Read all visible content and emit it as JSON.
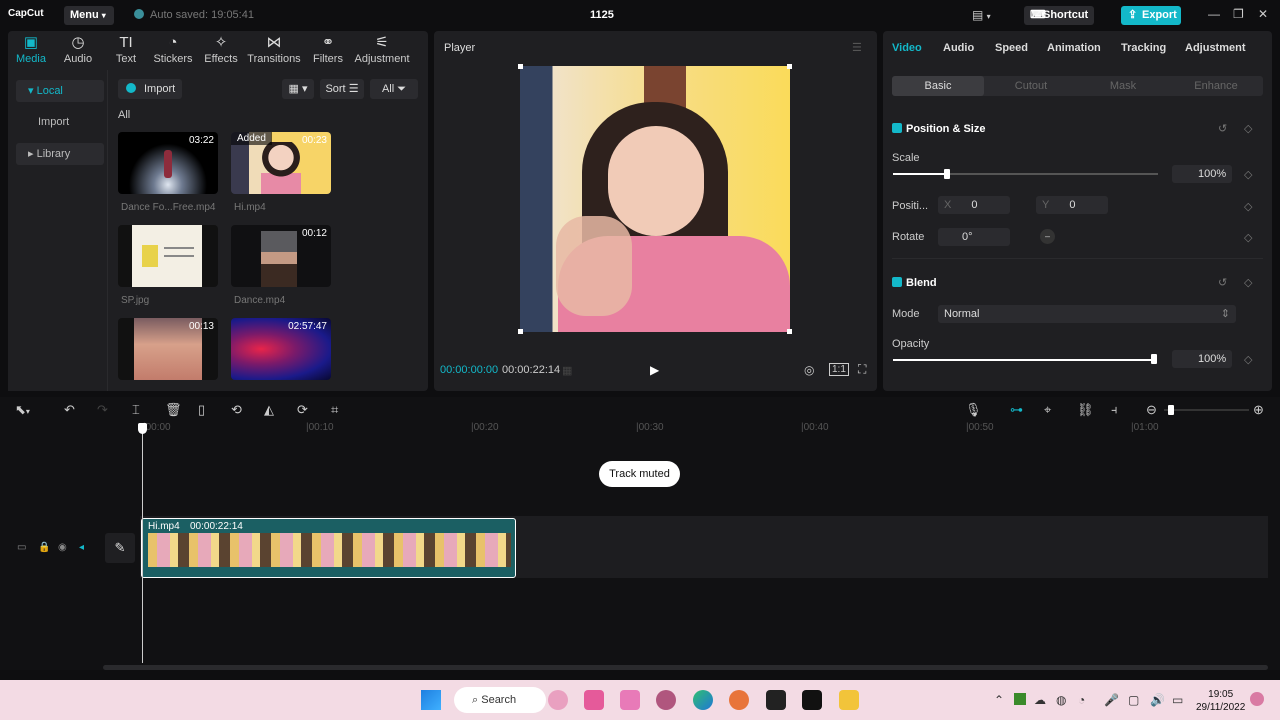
{
  "app": {
    "logo": "CapCut",
    "menu": "Menu",
    "autosave": "Auto saved: 19:05:41",
    "title": "1125",
    "shortcut": "Shortcut",
    "export": "Export"
  },
  "media_tabs": [
    {
      "label": "Media",
      "icon": "media-icon",
      "active": true
    },
    {
      "label": "Audio",
      "icon": "audio-icon"
    },
    {
      "label": "Text",
      "icon": "text-icon"
    },
    {
      "label": "Stickers",
      "icon": "stickers-icon"
    },
    {
      "label": "Effects",
      "icon": "effects-icon"
    },
    {
      "label": "Transitions",
      "icon": "transitions-icon"
    },
    {
      "label": "Filters",
      "icon": "filters-icon"
    },
    {
      "label": "Adjustment",
      "icon": "adjustment-icon"
    }
  ],
  "sidebar": {
    "local": "Local",
    "import": "Import",
    "library": "Library"
  },
  "media": {
    "import": "Import",
    "sort": "Sort",
    "all": "All",
    "all_label": "All",
    "items": [
      {
        "name": "Dance Fo...Free.mp4",
        "duration": "03:22"
      },
      {
        "name": "Hi.mp4",
        "duration": "00:23",
        "badge": "Added"
      },
      {
        "name": "SP.jpg",
        "duration": ""
      },
      {
        "name": "Dance.mp4",
        "duration": "00:12"
      },
      {
        "name": "",
        "duration": "00:13"
      },
      {
        "name": "",
        "duration": "02:57:47"
      }
    ]
  },
  "player": {
    "title": "Player",
    "current_time": "00:00:00:00",
    "total_time": "00:00:22:14"
  },
  "props": {
    "tabs": [
      "Video",
      "Audio",
      "Speed",
      "Animation",
      "Tracking",
      "Adjustment"
    ],
    "subtabs": [
      "Basic",
      "Cutout",
      "Mask",
      "Enhance"
    ],
    "position_size": "Position & Size",
    "scale_label": "Scale",
    "scale_value": "100%",
    "scale_level": 0.2,
    "position_label": "Positi...",
    "x_label": "X",
    "x_value": "0",
    "y_label": "Y",
    "y_value": "0",
    "rotate_label": "Rotate",
    "rotate_value": "0°",
    "blend": "Blend",
    "mode_label": "Mode",
    "mode_value": "Normal",
    "opacity_label": "Opacity",
    "opacity_value": "100%"
  },
  "timeline": {
    "ruler": [
      "|00:00",
      "|00:10",
      "|00:20",
      "|00:30",
      "|00:40",
      "|00:50",
      "|01:00"
    ],
    "track_muted": "Track muted",
    "clip_name": "Hi.mp4",
    "clip_duration": "00:00:22:14"
  },
  "taskbar": {
    "search": "Search",
    "time": "19:05",
    "date": "29/11/2022"
  },
  "colors": {
    "accent": "#13b8c9",
    "clip": "#1b5f63"
  }
}
